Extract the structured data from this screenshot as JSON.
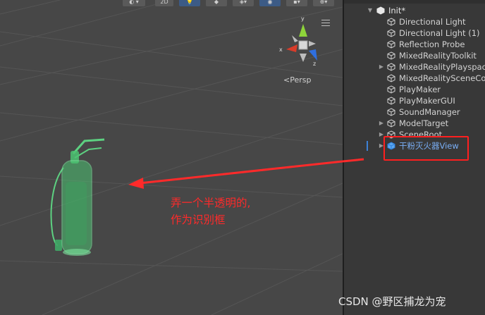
{
  "scene": {
    "toolbar": {
      "mode_2d": "2D"
    },
    "gizmo": {
      "axis_y": "y",
      "axis_x": "x",
      "axis_z": "z",
      "projection_label": "Persp"
    },
    "annotation": {
      "line1": "弄一个半透明的,",
      "line2": "作为识别框"
    },
    "colors": {
      "annotation": "#ff2a2a",
      "extinguisher": "#4cc372",
      "selection_box": "#ff1f1f"
    }
  },
  "hierarchy": {
    "root": {
      "label": "Init*",
      "icon": "unity-scene-icon"
    },
    "items": [
      {
        "label": "Directional Light",
        "icon": "cube-icon",
        "has_children": false
      },
      {
        "label": "Directional Light (1)",
        "icon": "cube-icon",
        "has_children": false
      },
      {
        "label": "Reflection Probe",
        "icon": "cube-icon",
        "has_children": false
      },
      {
        "label": "MixedRealityToolkit",
        "icon": "cube-icon",
        "has_children": false
      },
      {
        "label": "MixedRealityPlayspace",
        "icon": "cube-icon",
        "has_children": true
      },
      {
        "label": "MixedRealitySceneContent",
        "icon": "cube-icon",
        "has_children": false
      },
      {
        "label": "PlayMaker",
        "icon": "cube-icon",
        "has_children": false
      },
      {
        "label": "PlayMakerGUI",
        "icon": "cube-icon",
        "has_children": false
      },
      {
        "label": "SoundManager",
        "icon": "cube-icon",
        "has_children": false
      },
      {
        "label": "ModelTarget",
        "icon": "cube-icon",
        "has_children": true
      },
      {
        "label": "SceneRoot",
        "icon": "cube-icon",
        "has_children": true
      },
      {
        "label": "干粉灭火器View",
        "icon": "blue-cube-icon",
        "has_children": true,
        "selected": true
      }
    ]
  },
  "watermark": "CSDN @野区捕龙为宠"
}
